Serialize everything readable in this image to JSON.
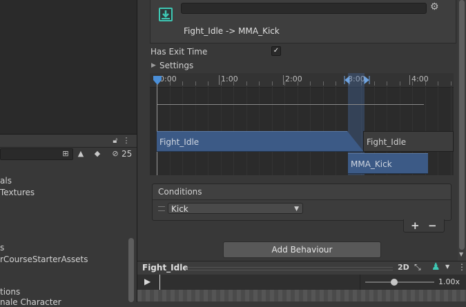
{
  "project": {
    "visibility_count": "25",
    "tree_items": [
      {
        "text": "als"
      },
      {
        "text": "Textures"
      },
      {
        "text": "s"
      },
      {
        "text": "rCourseStarterAssets"
      },
      {
        "text": "tions"
      },
      {
        "text": "nale Character"
      }
    ]
  },
  "inspector": {
    "transition_title": "Fight_Idle -> MMA_Kick",
    "has_exit_time_label": "Has Exit Time",
    "has_exit_time_checked": true,
    "has_exit_time_mark": "✓",
    "settings_label": "Settings",
    "timeline": {
      "ticks": [
        "0:00",
        "1:00",
        "2:00",
        "3:00",
        "4:00"
      ],
      "source_clip": "Fight_Idle",
      "source_clip_repeat": "Fight_Idle",
      "destination_clip": "MMA_Kick"
    },
    "conditions": {
      "header": "Conditions",
      "items": [
        {
          "parameter": "Kick"
        }
      ],
      "add_label": "+",
      "remove_label": "−"
    },
    "add_behaviour_label": "Add Behaviour"
  },
  "preview": {
    "title": "Fight_Idle",
    "mode_2d": "2D",
    "speed": "1.00x",
    "speed_fraction": 0.42
  },
  "colors": {
    "clip_blue": "#3c5a86",
    "panel_bg": "#383838",
    "accent_cyan": "#3ec8b4"
  }
}
